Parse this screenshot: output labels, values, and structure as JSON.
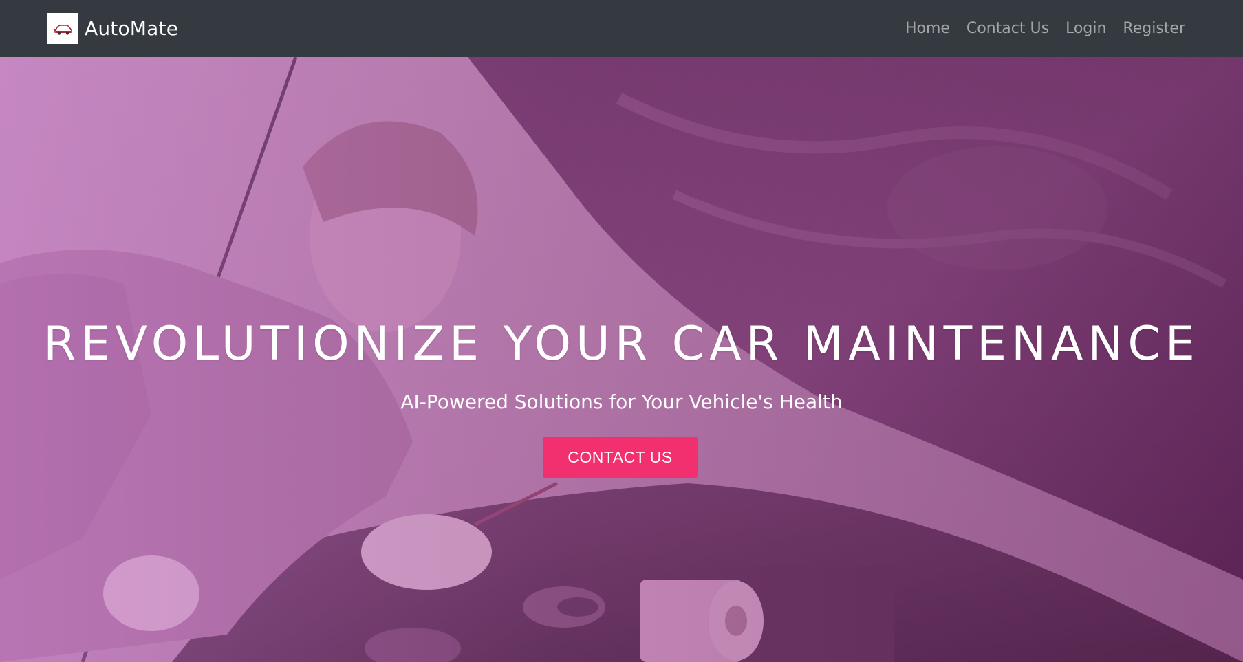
{
  "navbar": {
    "brand_name": "AutoMate",
    "logo_icon": "car-logo-icon",
    "links": [
      {
        "label": "Home"
      },
      {
        "label": "Contact Us"
      },
      {
        "label": "Login"
      },
      {
        "label": "Register"
      }
    ]
  },
  "hero": {
    "title": "REVOLUTIONIZE YOUR CAR MAINTENANCE",
    "subtitle": "AI-Powered Solutions for Your Vehicle's Health",
    "cta_label": "CONTACT US",
    "background_image": "woman-inspecting-car-engine-photo",
    "overlay_color": "#9b4f94",
    "cta_color": "#f2306f"
  },
  "colors": {
    "navbar_bg": "#343a40",
    "nav_link": "#9a9da1",
    "text": "#ffffff"
  }
}
